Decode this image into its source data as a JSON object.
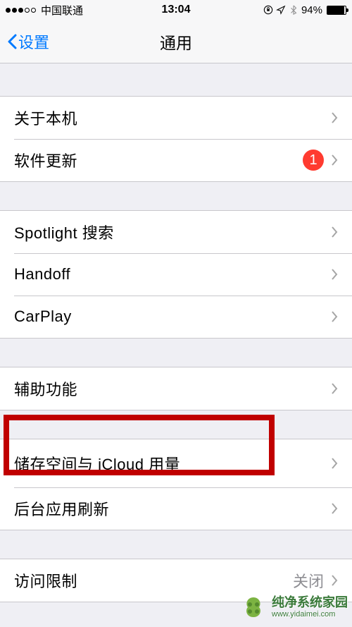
{
  "status": {
    "carrier": "中国联通",
    "time": "13:04",
    "battery_pct": "94%"
  },
  "nav": {
    "back_label": "设置",
    "title": "通用"
  },
  "cells": {
    "about": "关于本机",
    "software_update": "软件更新",
    "software_update_badge": "1",
    "spotlight": "Spotlight 搜索",
    "handoff": "Handoff",
    "carplay": "CarPlay",
    "accessibility": "辅助功能",
    "storage": "储存空间与 iCloud 用量",
    "background_refresh": "后台应用刷新",
    "restrictions": "访问限制",
    "restrictions_value": "关闭"
  },
  "watermark": {
    "title": "纯净系统家园",
    "url": "www.yidaimei.com"
  }
}
